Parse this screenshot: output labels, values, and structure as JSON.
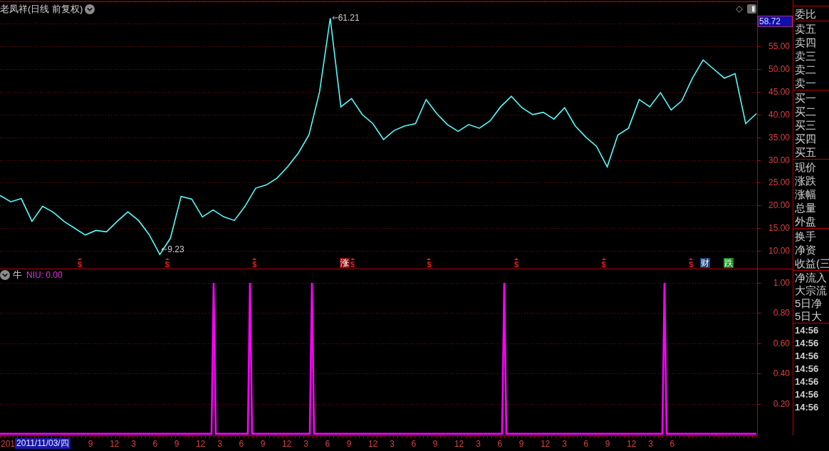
{
  "chart_header": {
    "title": "老凤祥(日线 前复权)"
  },
  "main_chart": {
    "cursor_price": "58.72",
    "chart_data": {
      "type": "line",
      "ylim": [
        6.1,
        65.2
      ],
      "yticks": [
        {
          "value": 10,
          "label": "10.00"
        },
        {
          "value": 15,
          "label": "15.00"
        },
        {
          "value": 20,
          "label": "20.00"
        },
        {
          "value": 25,
          "label": "25.00"
        },
        {
          "value": 30,
          "label": "30.00"
        },
        {
          "value": 35,
          "label": "35.00"
        },
        {
          "value": 40,
          "label": "40.00"
        },
        {
          "value": 45,
          "label": "45.00"
        },
        {
          "value": 50,
          "label": "50.00"
        },
        {
          "value": 55,
          "label": "55.00"
        }
      ],
      "grid": true,
      "series": [
        {
          "color": "#54fcfc",
          "values": [
            22.2,
            20.8,
            21.5,
            16.5,
            19.8,
            18.5,
            16.5,
            15,
            13.5,
            14.5,
            14.2,
            16.5,
            18.6,
            16.7,
            13.6,
            9.2,
            12.8,
            22,
            21.4,
            17.5,
            19,
            17.5,
            16.7,
            19.8,
            23.8,
            24.5,
            26,
            28.5,
            31.5,
            35.5,
            45,
            61.2,
            41.7,
            43.5,
            40,
            38,
            34.5,
            36.5,
            37.5,
            38,
            43.3,
            40.2,
            37.8,
            36.3,
            37.8,
            37,
            38.6,
            41.7,
            44,
            41.5,
            40,
            40.5,
            39,
            41.5,
            37.5,
            35,
            33,
            28.5,
            35.5,
            37,
            43.3,
            41.7,
            44.8,
            41,
            43,
            48,
            52,
            50,
            48,
            49,
            38,
            40.2
          ]
        }
      ],
      "annotations": [
        "61.21",
        "9.23"
      ]
    },
    "events": [
      [
        {
          "kind": "dollar",
          "text": "$"
        }
      ],
      [
        {
          "kind": "dollar",
          "text": "$"
        }
      ],
      [
        {
          "kind": "dollar",
          "text": "$"
        }
      ],
      [
        {
          "kind": "tag",
          "text": "涨",
          "color": "#8c1414"
        },
        {
          "kind": "dollar",
          "text": "$"
        }
      ],
      [
        {
          "kind": "dollar",
          "text": "$"
        }
      ],
      [
        {
          "kind": "dollar",
          "text": "$"
        }
      ],
      [
        {
          "kind": "dollar",
          "text": "$"
        }
      ],
      [
        {
          "kind": "dollar",
          "text": "$"
        },
        {
          "kind": "tag",
          "text": "财",
          "color": "#1c4476"
        },
        {
          "kind": "tag",
          "text": "跌",
          "color": "#1f8a24"
        }
      ]
    ]
  },
  "indicator": {
    "name": "牛",
    "legend": "NIU: 0.00",
    "chart_data": {
      "type": "line",
      "ylim": [
        -0.01,
        1.09
      ],
      "yticks": [
        {
          "value": 0.2,
          "label": "0.20"
        },
        {
          "value": 0.4,
          "label": "0.40"
        },
        {
          "value": 0.6,
          "label": "0.60"
        },
        {
          "value": 0.8,
          "label": "0.80"
        },
        {
          "value": 1,
          "label": "1.00"
        }
      ],
      "grid": true,
      "series": [
        {
          "color": "#ff00ff",
          "values": [
            0,
            0,
            0,
            0,
            0,
            0,
            0,
            0,
            0,
            0,
            0,
            0,
            0,
            0,
            0,
            0,
            0,
            0,
            0,
            0,
            0,
            0,
            0,
            0,
            0,
            0,
            0,
            0,
            0,
            0,
            0,
            0,
            0,
            0,
            0,
            0,
            0,
            0,
            0,
            0,
            0,
            0,
            0,
            0,
            0,
            0,
            0,
            0,
            0,
            0,
            0,
            0,
            0,
            0,
            0,
            0,
            0,
            0,
            0,
            0,
            0,
            0,
            0,
            0,
            0,
            0,
            0,
            0,
            0,
            0,
            0,
            0,
            0,
            0,
            0,
            0,
            0,
            0,
            0,
            0,
            0,
            0,
            0,
            0,
            0,
            0,
            0,
            0,
            0,
            0,
            0,
            0,
            0,
            0,
            0,
            0,
            0,
            0,
            0,
            0,
            1,
            0,
            0,
            0,
            0,
            0,
            0,
            0,
            0,
            0,
            0,
            0,
            0,
            0,
            0,
            0,
            0,
            1,
            0,
            0,
            0,
            0,
            0,
            0,
            0,
            0,
            0,
            0,
            0,
            0,
            0,
            0,
            0,
            0,
            0,
            0,
            0,
            0,
            0,
            0,
            0,
            0,
            0,
            0,
            0,
            0,
            1,
            0,
            0,
            0,
            0,
            0,
            0,
            0,
            0,
            0,
            0,
            0,
            0,
            0,
            0,
            0,
            0,
            0,
            0,
            0,
            0,
            0,
            0,
            0,
            0,
            0,
            0,
            0,
            0,
            0,
            0,
            0,
            0,
            0,
            0,
            0,
            0,
            0,
            0,
            0,
            0,
            0,
            0,
            0,
            0,
            0,
            0,
            0,
            0,
            0,
            0,
            0,
            0,
            0,
            0,
            0,
            0,
            0,
            0,
            0,
            0,
            0,
            0,
            0,
            0,
            0,
            0,
            0,
            0,
            0,
            0,
            0,
            0,
            0,
            0,
            0,
            0,
            0,
            0,
            0,
            0,
            0,
            0,
            0,
            0,
            0,
            0,
            0,
            0,
            0,
            1,
            0,
            0,
            0,
            0,
            0,
            0,
            0,
            0,
            0,
            0,
            0,
            0,
            0,
            0,
            0,
            0,
            0,
            0,
            0,
            0,
            0,
            0,
            0,
            0,
            0,
            0,
            0,
            0,
            0,
            0,
            0,
            0,
            0,
            0,
            0,
            0,
            0,
            0,
            0,
            0,
            0,
            0,
            0,
            0,
            0,
            0,
            0,
            0,
            0,
            0,
            0,
            0,
            0,
            0,
            0,
            0,
            0,
            0,
            0,
            0,
            0,
            0,
            0,
            0,
            0,
            0,
            0,
            0,
            0,
            0,
            0,
            0,
            0,
            0,
            1,
            0,
            0,
            0,
            0,
            0,
            0,
            0,
            0,
            0,
            0,
            0,
            0,
            0,
            0,
            0,
            0,
            0,
            0,
            0,
            0,
            0,
            0,
            0,
            0,
            0,
            0,
            0,
            0,
            0,
            0,
            0,
            0,
            0,
            0,
            0,
            0,
            0,
            0,
            0,
            0,
            0,
            0,
            0
          ]
        }
      ]
    }
  },
  "time_axis": {
    "start_label": "201",
    "cursor_date": "2011/11/03/四",
    "labels": [
      "9",
      "12",
      "3",
      "6",
      "9",
      "12",
      "3",
      "6",
      "9",
      "12",
      "3",
      "6",
      "9",
      "12",
      "3",
      "6",
      "9",
      "12",
      "3",
      "6",
      "9",
      "12",
      "3",
      "6",
      "9",
      "12",
      "3",
      "6"
    ]
  },
  "quote_panel": {
    "sections": [
      {
        "kind": "labels",
        "rows": [
          "委比"
        ]
      },
      {
        "kind": "labels",
        "rows": [
          "卖五",
          "卖四",
          "卖三",
          "卖二",
          "卖一"
        ]
      },
      {
        "kind": "labels",
        "rows": [
          "买一",
          "买二",
          "买三",
          "买四",
          "买五"
        ]
      },
      {
        "kind": "labels",
        "rows": [
          "现价",
          "涨跌",
          "涨幅",
          "总量",
          "外盘"
        ]
      },
      {
        "kind": "labels",
        "rows": [
          "换手",
          "净资",
          "收益(三"
        ]
      },
      {
        "kind": "compact",
        "rows": [
          "净流入",
          "大宗流",
          "5日净",
          "5日大"
        ]
      },
      {
        "kind": "times",
        "rows": [
          "14:56",
          "14:56",
          "14:56",
          "14:56",
          "14:56",
          "14:56",
          "14:56"
        ]
      }
    ]
  }
}
